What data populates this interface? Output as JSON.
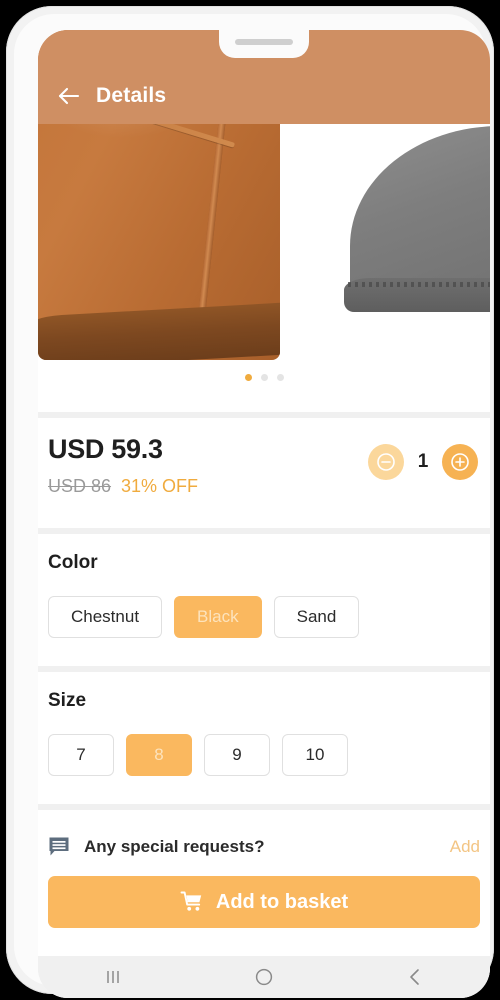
{
  "appbar": {
    "title": "Details",
    "back_icon": "arrow-left-icon",
    "background_color": "#cf8f63"
  },
  "gallery": {
    "slides": [
      {
        "alt": "Chestnut suede boot close-up"
      },
      {
        "alt": "Grey suede boot toe close-up"
      }
    ],
    "dots": [
      {
        "active": true
      },
      {
        "active": false
      },
      {
        "active": false
      }
    ],
    "active_index": 0
  },
  "price": {
    "current": "USD 59.3",
    "original": "USD 86",
    "discount": "31% OFF",
    "discount_color": "#f0ab3e"
  },
  "quantity": {
    "value": "1",
    "decrement_icon": "minus-circle-icon",
    "increment_icon": "plus-circle-icon"
  },
  "color": {
    "title": "Color",
    "options": [
      {
        "label": "Chestnut",
        "selected": false
      },
      {
        "label": "Black",
        "selected": true
      },
      {
        "label": "Sand",
        "selected": false
      }
    ]
  },
  "size": {
    "title": "Size",
    "options": [
      {
        "label": "7",
        "selected": false
      },
      {
        "label": "8",
        "selected": true
      },
      {
        "label": "9",
        "selected": false
      },
      {
        "label": "10",
        "selected": false
      }
    ]
  },
  "requests": {
    "icon": "message-icon",
    "label": "Any special requests?",
    "action_label": "Add"
  },
  "basket": {
    "label": "Add to basket",
    "icon": "shopping-cart-icon",
    "color": "#fab85f"
  },
  "navbar": {
    "recents_icon": "recents-icon",
    "home_icon": "home-circle-icon",
    "back_icon": "chevron-left-icon"
  }
}
